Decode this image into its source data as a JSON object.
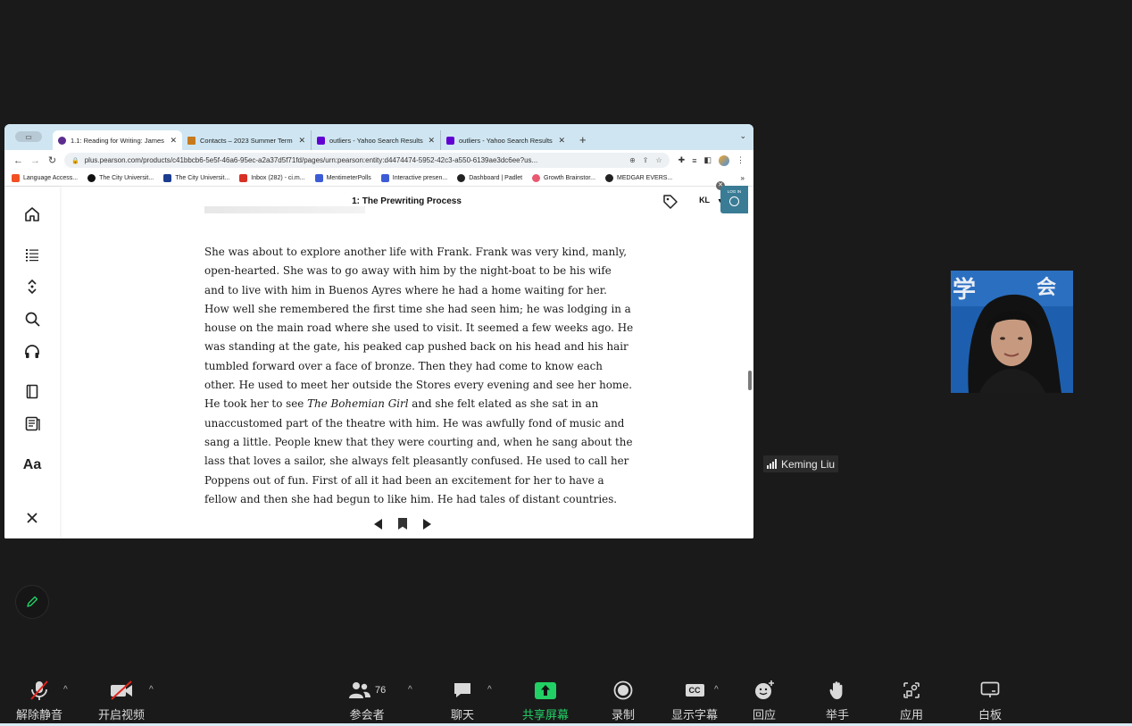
{
  "browser": {
    "tabs": [
      {
        "title": "1.1: Reading for Writing: James",
        "color": "#5b2d8e",
        "active": true
      },
      {
        "title": "Contacts – 2023 Summer Term",
        "color": "#c77a1d",
        "active": false
      },
      {
        "title": "outliers - Yahoo Search Results",
        "color": "#6001d2",
        "active": false
      },
      {
        "title": "outliers - Yahoo Search Results",
        "color": "#6001d2",
        "active": false
      }
    ],
    "url": "plus.pearson.com/products/c41bbcb6-5e5f-46a6-95ec-a2a37d5f71fd/pages/urn:pearson:entity:d4474474-5952-42c3-a550-6139ae3dc6ee?us...",
    "bookmarks": [
      {
        "label": "Language Access...",
        "color": "#f25022"
      },
      {
        "label": "The City Universit...",
        "color": "#111111"
      },
      {
        "label": "The City Universit...",
        "color": "#1a3d8f"
      },
      {
        "label": "Inbox (282) - ci.m...",
        "color": "#d93025"
      },
      {
        "label": "MentimeterPolls",
        "color": "#3c5cd6"
      },
      {
        "label": "Interactive presen...",
        "color": "#3c5cd6"
      },
      {
        "label": "Dashboard | Padlet",
        "color": "#222222"
      },
      {
        "label": "Growth Brainstor...",
        "color": "#e85a71"
      },
      {
        "label": "MEDGAR EVERS...",
        "color": "#222222"
      }
    ],
    "bookmarks_more": "»"
  },
  "reader": {
    "chapter_title": "1: The Prewriting Process",
    "user_initials": "KL",
    "passage_lines": [
      "She was about to explore another life with Frank. Frank was very kind, manly,",
      "open-hearted. She was to go away with him by the night-boat to be his wife",
      "and to live with him in Buenos Ayres where he had a home waiting for her.",
      "How well she remembered the first time she had seen him; he was lodging in a",
      "house on the main road where she used to visit. It seemed a few weeks ago. He",
      "was standing at the gate, his peaked cap pushed back on his head and his hair",
      "tumbled forward over a face of bronze. Then they had come to know each",
      "other. He used to meet her outside the Stores every evening and see her home."
    ],
    "line9_before": "He took her to see ",
    "line9_italic": "The Bohemian Girl",
    "line9_after": " and she felt elated as she sat in an",
    "passage_lines_b": [
      "unaccustomed part of the theatre with him. He was awfully fond of music and",
      "sang a little. People knew that they were courting and, when he sang about the",
      "lass that loves a sailor, she always felt pleasantly confused. He used to call her",
      "Poppens out of fun. First of all it had been an excitement for her to have a",
      "fellow and then she had begun to like him. He had tales of distant countries."
    ],
    "login_widget_text": "LOG IN"
  },
  "participant": {
    "name": "Keming Liu"
  },
  "toolbar": {
    "unmute": "解除静音",
    "start_video": "开启视频",
    "participants": "参会者",
    "participant_count": "76",
    "chat": "聊天",
    "share_screen": "共享屏幕",
    "record": "录制",
    "captions": "显示字幕",
    "reactions": "回应",
    "raise_hand": "举手",
    "apps": "应用",
    "whiteboard": "白板",
    "cc_text": "CC"
  }
}
